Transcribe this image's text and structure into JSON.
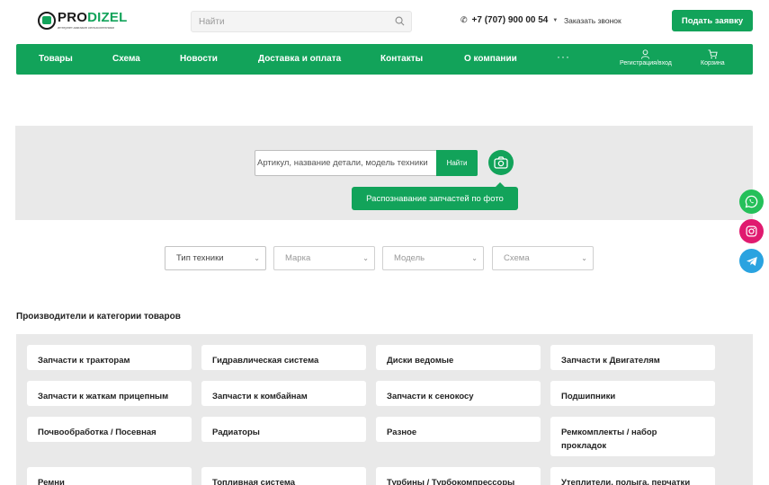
{
  "header": {
    "logo": {
      "brand_dark": "PRO",
      "brand_green": "DIZEL",
      "tagline": "интернет-магазин сельхозтехники"
    },
    "search": {
      "placeholder": "Найти"
    },
    "phone": "+7 (707) 900 00 54",
    "callback_label": "Заказать звонок",
    "request_button": "Подать заявку"
  },
  "nav": {
    "items": [
      "Товары",
      "Схема",
      "Новости",
      "Доставка и оплата",
      "Контакты",
      "О компании"
    ],
    "more": "···",
    "account_label": "Регистрация/вход",
    "cart_label": "Корзина"
  },
  "parts_search": {
    "placeholder": "Артикул, название детали, модель техники",
    "button": "Найти",
    "photo_tip": "Распознавание запчастей по фото"
  },
  "filters": [
    {
      "label": "Тип техники",
      "active": true
    },
    {
      "label": "Марка",
      "active": false
    },
    {
      "label": "Модель",
      "active": false
    },
    {
      "label": "Схема",
      "active": false
    }
  ],
  "categories": {
    "title": "Производители и категории товаров",
    "items": [
      "Запчасти к тракторам",
      "Гидравлическая система",
      "Диски ведомые",
      "Запчасти к Двигателям",
      "Запчасти к жаткам прицепным",
      "Запчасти к комбайнам",
      "Запчасти к сенокосу",
      "Подшипники",
      "Почвообработка / Посевная",
      "Радиаторы",
      "Разное",
      "Ремкомплекты / набор прокладок",
      "Ремни",
      "Топливная система",
      "Турбины / Турбокомпрессоры",
      "Утеплители, полыга, перчатки"
    ]
  },
  "socials": [
    "whatsapp",
    "instagram",
    "telegram"
  ],
  "colors": {
    "brand_green": "#12a35a",
    "panel_gray": "#e9e9e9"
  }
}
